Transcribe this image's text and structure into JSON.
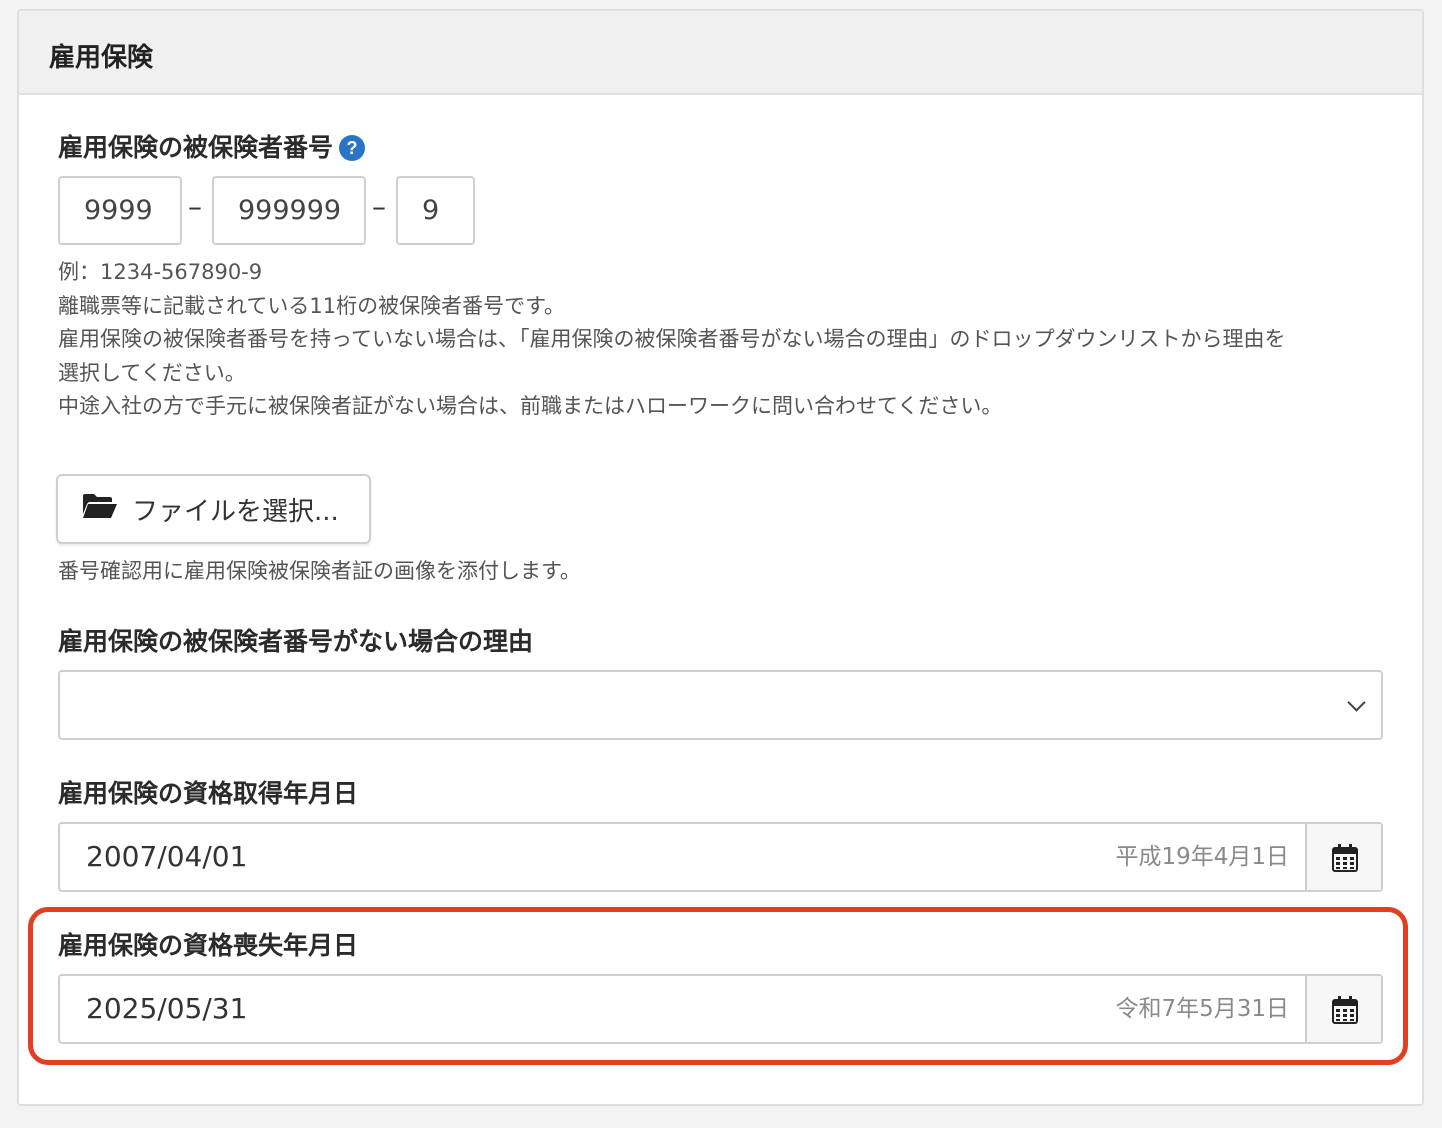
{
  "section": {
    "title": "雇用保険"
  },
  "insured_number": {
    "label": "雇用保険の被保険者番号",
    "help_icon": "question-circle-icon",
    "part1": "9999",
    "part2": "999999",
    "part3": "9",
    "separator": "–",
    "help_lines": [
      "例：1234-567890-9",
      "離職票等に記載されている11桁の被保険者番号です。",
      "雇用保険の被保険者番号を持っていない場合は、「雇用保険の被保険者番号がない場合の理由」のドロップダウンリストから理由を",
      "選択してください。",
      "中途入社の方で手元に被保険者証がない場合は、前職またはハローワークに問い合わせてください。"
    ]
  },
  "file_upload": {
    "icon": "folder-open-icon",
    "button_label": "ファイルを選択...",
    "help": "番号確認用に雇用保険被保険者証の画像を添付します。"
  },
  "no_number_reason": {
    "label": "雇用保険の被保険者番号がない場合の理由",
    "selected": ""
  },
  "acquisition_date": {
    "label": "雇用保険の資格取得年月日",
    "value": "2007/04/01",
    "era": "平成19年4月1日",
    "icon": "calendar-icon"
  },
  "loss_date": {
    "label": "雇用保険の資格喪失年月日",
    "value": "2025/05/31",
    "era": "令和7年5月31日",
    "icon": "calendar-icon"
  },
  "colors": {
    "highlight": "#e23f22",
    "help_icon": "#2a73c5"
  }
}
